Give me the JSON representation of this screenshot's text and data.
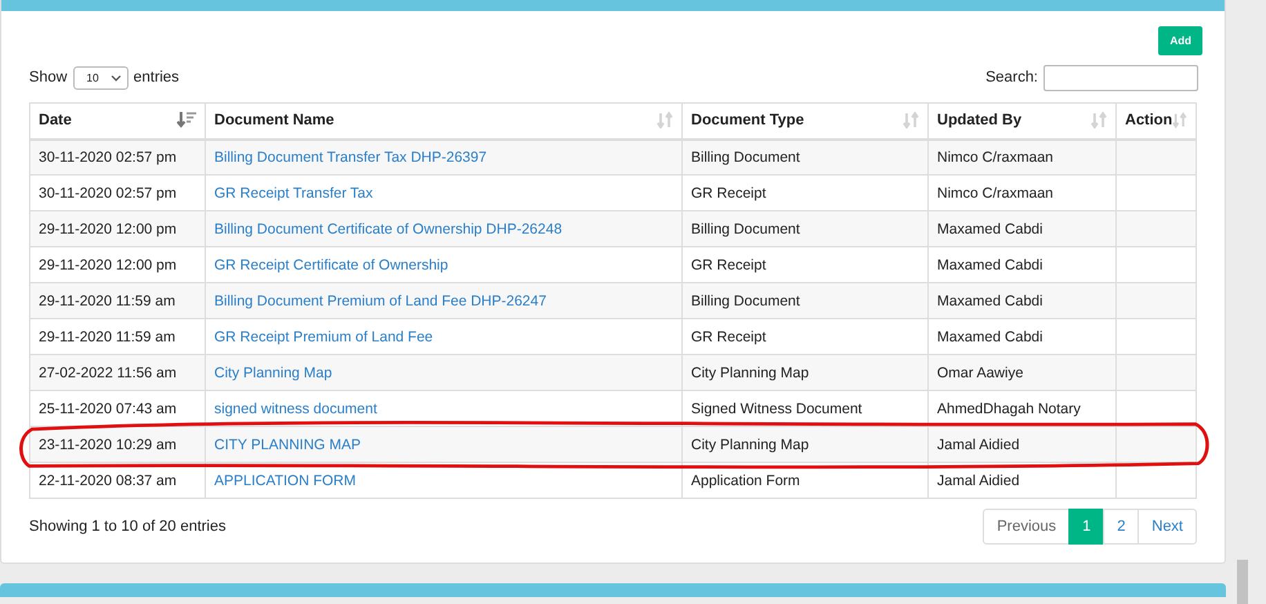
{
  "add_button": "Add",
  "length": {
    "label_before": "Show",
    "value": "10",
    "label_after": "entries"
  },
  "search": {
    "label": "Search:"
  },
  "table": {
    "columns": [
      {
        "label": "Date",
        "sorted": true
      },
      {
        "label": "Document Name",
        "sorted": false
      },
      {
        "label": "Document Type",
        "sorted": false
      },
      {
        "label": "Updated By",
        "sorted": false
      },
      {
        "label": "Action",
        "sorted": false
      }
    ],
    "rows": [
      {
        "date": "30-11-2020 02:57 pm",
        "name": "Billing Document Transfer Tax DHP-26397",
        "type": "Billing Document",
        "by": "Nimco C/raxmaan",
        "circled": false
      },
      {
        "date": "30-11-2020 02:57 pm",
        "name": "GR Receipt Transfer Tax",
        "type": "GR Receipt",
        "by": "Nimco C/raxmaan",
        "circled": false
      },
      {
        "date": "29-11-2020 12:00 pm",
        "name": "Billing Document Certificate of Ownership DHP-26248",
        "type": "Billing Document",
        "by": "Maxamed Cabdi",
        "circled": false
      },
      {
        "date": "29-11-2020 12:00 pm",
        "name": "GR Receipt Certificate of Ownership",
        "type": "GR Receipt",
        "by": "Maxamed Cabdi",
        "circled": false
      },
      {
        "date": "29-11-2020 11:59 am",
        "name": "Billing Document Premium of Land Fee DHP-26247",
        "type": "Billing Document",
        "by": "Maxamed Cabdi",
        "circled": false
      },
      {
        "date": "29-11-2020 11:59 am",
        "name": "GR Receipt Premium of Land Fee",
        "type": "GR Receipt",
        "by": "Maxamed Cabdi",
        "circled": false
      },
      {
        "date": "27-02-2022 11:56 am",
        "name": "City Planning Map",
        "type": "City Planning Map",
        "by": "Omar Aawiye",
        "circled": false
      },
      {
        "date": "25-11-2020 07:43 am",
        "name": "signed witness document",
        "type": "Signed Witness Document",
        "by": "AhmedDhagah Notary",
        "circled": false
      },
      {
        "date": "23-11-2020 10:29 am",
        "name": "CITY PLANNING MAP",
        "type": "City Planning Map",
        "by": "Jamal Aidied",
        "circled": true
      },
      {
        "date": "22-11-2020 08:37 am",
        "name": "APPLICATION FORM",
        "type": "Application Form",
        "by": "Jamal Aidied",
        "circled": false
      }
    ]
  },
  "info": "Showing 1 to 10 of 20 entries",
  "pagination": [
    {
      "label": "Previous",
      "kind": "nav",
      "selected": false
    },
    {
      "label": "1",
      "kind": "page",
      "selected": true
    },
    {
      "label": "2",
      "kind": "page",
      "selected": false
    },
    {
      "label": "Next",
      "kind": "nav",
      "selected": false
    }
  ]
}
